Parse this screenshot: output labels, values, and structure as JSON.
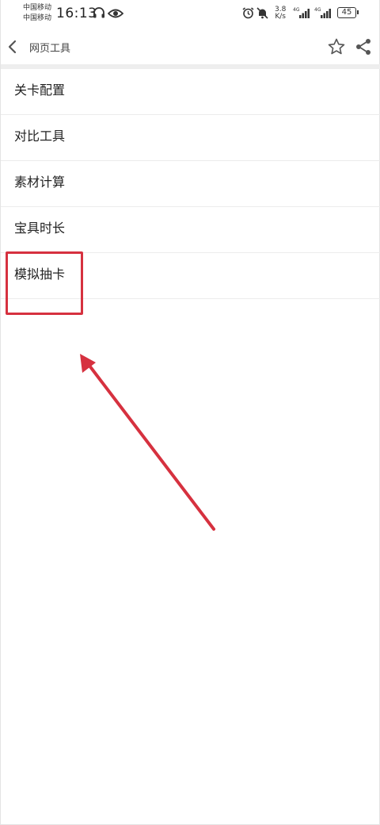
{
  "status_bar": {
    "carrier_1": "中国移动",
    "carrier_2": "中国移动",
    "time": "16:13",
    "net_speed_value": "3.8",
    "net_speed_unit": "K/s",
    "signal_1_label": "4G",
    "signal_2_label": "4G",
    "battery_level": "45"
  },
  "toolbar": {
    "title": "网页工具",
    "back_icon": "chevron-left-icon",
    "favorite_icon": "star-outline-icon",
    "share_icon": "share-icon"
  },
  "menu": {
    "items": [
      {
        "label": "关卡配置"
      },
      {
        "label": "对比工具"
      },
      {
        "label": "素材计算"
      },
      {
        "label": "宝具时长"
      },
      {
        "label": "模拟抽卡"
      }
    ]
  },
  "annotation": {
    "highlight_color": "#d6313f",
    "arrow_color": "#d6313f",
    "highlighted_item": "模拟抽卡"
  }
}
